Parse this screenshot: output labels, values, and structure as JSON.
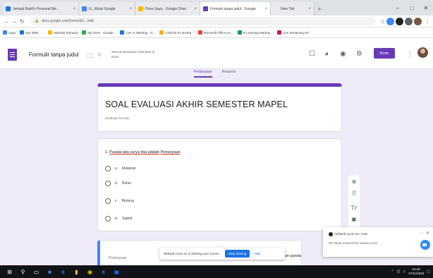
{
  "browser": {
    "tabs": [
      {
        "label": "Jemput Bukti's Personal Me...",
        "color": "#1a73e8",
        "active": false
      },
      {
        "label": "G...Mulai Google",
        "color": "#4285f4",
        "active": false
      },
      {
        "label": "Drive Saya - Google Drive",
        "color": "#fbbc04",
        "active": false
      },
      {
        "label": "Formulir tanpa judul - Google",
        "color": "#673ab7",
        "active": true
      },
      {
        "label": "New Tab",
        "color": "#e8eaed",
        "active": false
      }
    ],
    "address": "docs.google.com/forms/d/1.../edit",
    "bookmarks": [
      {
        "label": "Apps",
        "color": "#4285f4"
      },
      {
        "label": "Dar lWiki - ...",
        "color": "#1a73e8"
      },
      {
        "label": "Sekolah Edmodo",
        "color": "#fbbc04"
      },
      {
        "label": "My Drive - Google...",
        "color": "#34a853"
      },
      {
        "label": "Live or Meeting - G...",
        "color": "#1a73e8"
      },
      {
        "label": "CODAS E-LEARN...",
        "color": "#f4b400"
      },
      {
        "label": "Microsoft Office Ho...",
        "color": "#ea4335"
      },
      {
        "label": "E-Learning Madras...",
        "color": "#0f9d58"
      },
      {
        "label": "Live Streaming NT...",
        "color": "#c2185b"
      }
    ]
  },
  "form_header": {
    "title": "Formulir tanpa judul",
    "saved_note": "Semua perubahan disimpan di Drive",
    "send_label": "Kirim"
  },
  "tabs": {
    "questions": "Pertanyaan",
    "responses": "Respons"
  },
  "title_card": {
    "title": "SOAL EVALUASI AKHIR SEMESTER MAPEL",
    "description": "Deskripsi formulir"
  },
  "question": {
    "number_prefix": "1.",
    "text": "Pusata tata surya kita adalah",
    "tail": "Pertanyaan",
    "options": [
      {
        "letter": "a.",
        "text": "Matahari"
      },
      {
        "letter": "b.",
        "text": "Bulan"
      },
      {
        "letter": "c.",
        "text": "Bintang"
      },
      {
        "letter": "d.",
        "text": "Satelit"
      }
    ]
  },
  "question2": {
    "placeholder": "Pertanyaan",
    "answer_type": "an ganda"
  },
  "share_bar": {
    "message": "whfweb.zoom.us is sharing your screen.",
    "stop_label": "Stop sharing",
    "hide_label": "Hide"
  },
  "notification": {
    "source": "whfweb.zoom.us  • now",
    "message": "Mr. Gelar entered the waiting room"
  },
  "taskbar": {
    "time": "10.26",
    "date": "27/11/2020"
  }
}
